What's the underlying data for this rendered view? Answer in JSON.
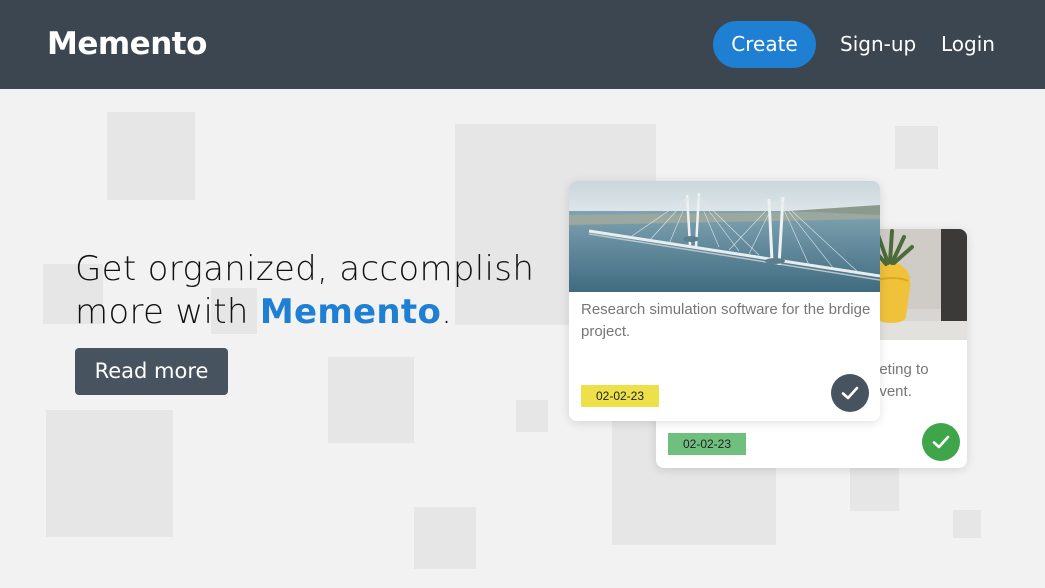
{
  "header": {
    "brand": "Memento",
    "nav": {
      "create": "Create",
      "signup": "Sign-up",
      "login": "Login"
    }
  },
  "hero": {
    "title_line1": "Get organized, accomplish",
    "title_line2_prefix": "more with ",
    "title_accent": "Memento",
    "title_suffix": ".",
    "read_more": "Read more"
  },
  "cards": [
    {
      "text": "Research simulation software for the brdige project.",
      "date": "02-02-23",
      "badge_color": "#ede049",
      "check_color": "#47535e",
      "image": "bridge-photo"
    },
    {
      "text": "eeting to\nevent.",
      "date": "02-02-23",
      "badge_color": "#6fbf7e",
      "check_color": "#3fa54a",
      "image": "plant-photo"
    }
  ],
  "colors": {
    "header_bg": "#3b4650",
    "accent": "#1e7fd3",
    "button_dark": "#47535e",
    "page_bg": "#f2f2f2"
  }
}
